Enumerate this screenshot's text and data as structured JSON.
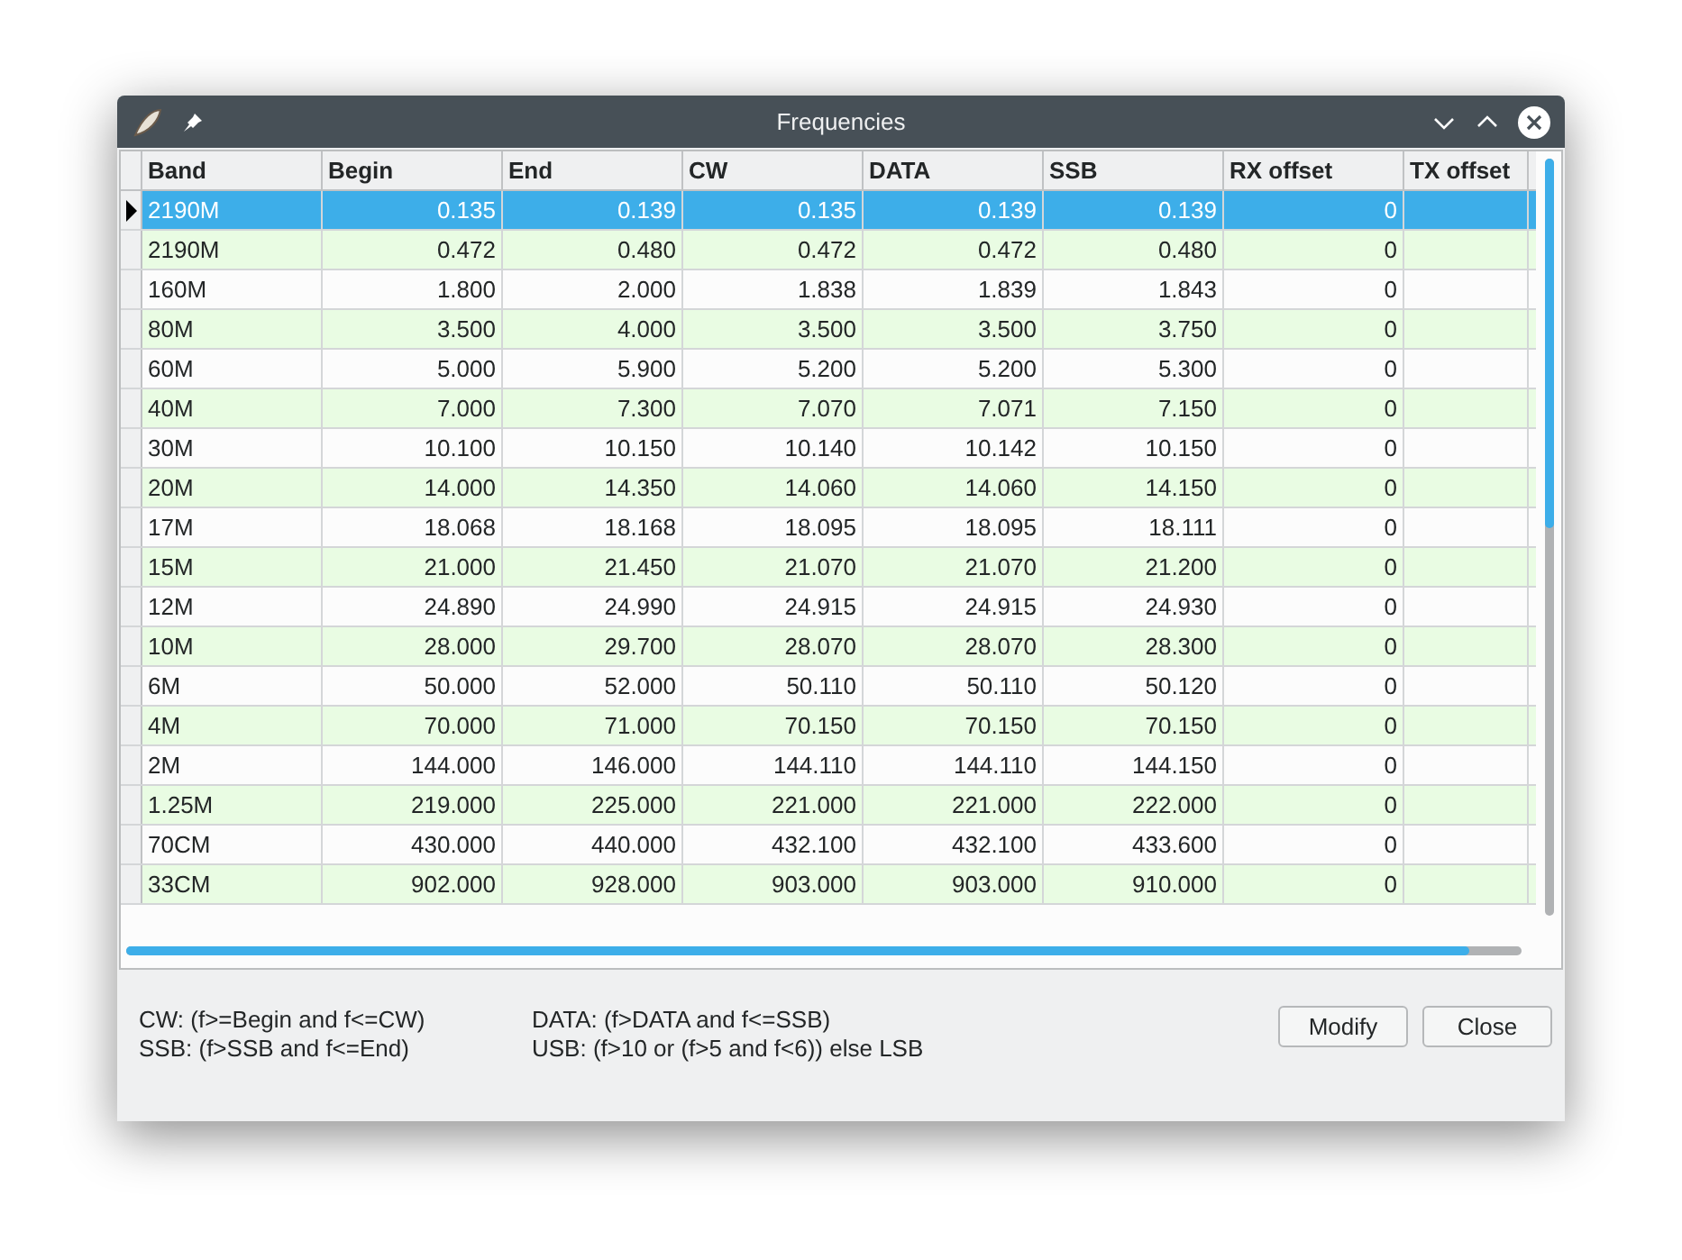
{
  "window": {
    "title": "Frequencies"
  },
  "table": {
    "columns": [
      "Band",
      "Begin",
      "End",
      "CW",
      "DATA",
      "SSB",
      "RX offset",
      "TX offset"
    ],
    "rows": [
      {
        "selected": true,
        "cells": [
          "2190M",
          "0.135",
          "0.139",
          "0.135",
          "0.139",
          "0.139",
          "0",
          ""
        ]
      },
      {
        "selected": false,
        "cells": [
          "2190M",
          "0.472",
          "0.480",
          "0.472",
          "0.472",
          "0.480",
          "0",
          ""
        ]
      },
      {
        "selected": false,
        "cells": [
          "160M",
          "1.800",
          "2.000",
          "1.838",
          "1.839",
          "1.843",
          "0",
          ""
        ]
      },
      {
        "selected": false,
        "cells": [
          "80M",
          "3.500",
          "4.000",
          "3.500",
          "3.500",
          "3.750",
          "0",
          ""
        ]
      },
      {
        "selected": false,
        "cells": [
          "60M",
          "5.000",
          "5.900",
          "5.200",
          "5.200",
          "5.300",
          "0",
          ""
        ]
      },
      {
        "selected": false,
        "cells": [
          "40M",
          "7.000",
          "7.300",
          "7.070",
          "7.071",
          "7.150",
          "0",
          ""
        ]
      },
      {
        "selected": false,
        "cells": [
          "30M",
          "10.100",
          "10.150",
          "10.140",
          "10.142",
          "10.150",
          "0",
          ""
        ]
      },
      {
        "selected": false,
        "cells": [
          "20M",
          "14.000",
          "14.350",
          "14.060",
          "14.060",
          "14.150",
          "0",
          ""
        ]
      },
      {
        "selected": false,
        "cells": [
          "17M",
          "18.068",
          "18.168",
          "18.095",
          "18.095",
          "18.111",
          "0",
          ""
        ]
      },
      {
        "selected": false,
        "cells": [
          "15M",
          "21.000",
          "21.450",
          "21.070",
          "21.070",
          "21.200",
          "0",
          ""
        ]
      },
      {
        "selected": false,
        "cells": [
          "12M",
          "24.890",
          "24.990",
          "24.915",
          "24.915",
          "24.930",
          "0",
          ""
        ]
      },
      {
        "selected": false,
        "cells": [
          "10M",
          "28.000",
          "29.700",
          "28.070",
          "28.070",
          "28.300",
          "0",
          ""
        ]
      },
      {
        "selected": false,
        "cells": [
          "6M",
          "50.000",
          "52.000",
          "50.110",
          "50.110",
          "50.120",
          "0",
          ""
        ]
      },
      {
        "selected": false,
        "cells": [
          "4M",
          "70.000",
          "71.000",
          "70.150",
          "70.150",
          "70.150",
          "0",
          ""
        ]
      },
      {
        "selected": false,
        "cells": [
          "2M",
          "144.000",
          "146.000",
          "144.110",
          "144.110",
          "144.150",
          "0",
          ""
        ]
      },
      {
        "selected": false,
        "cells": [
          "1.25M",
          "219.000",
          "225.000",
          "221.000",
          "221.000",
          "222.000",
          "0",
          ""
        ]
      },
      {
        "selected": false,
        "cells": [
          "70CM",
          "430.000",
          "440.000",
          "432.100",
          "432.100",
          "433.600",
          "0",
          ""
        ]
      },
      {
        "selected": false,
        "cells": [
          "33CM",
          "902.000",
          "928.000",
          "903.000",
          "903.000",
          "910.000",
          "0",
          ""
        ]
      }
    ]
  },
  "legend": [
    "CW: (f>=Begin and f<=CW)",
    "DATA: (f>DATA and f<=SSB)",
    "SSB: (f>SSB and f<=End)",
    "USB: (f>10 or (f>5 and f<6)) else LSB"
  ],
  "buttons": [
    "Modify",
    "Close"
  ]
}
